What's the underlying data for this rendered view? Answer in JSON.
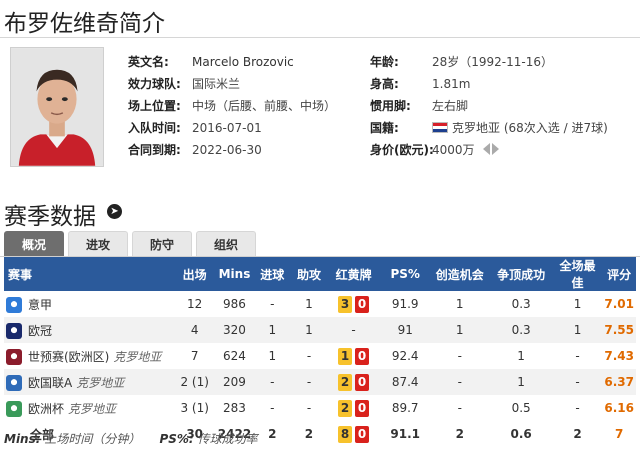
{
  "page_title": "布罗佐维奇简介",
  "profile": {
    "name_label": "英文名:",
    "name_value": "Marcelo Brozovic",
    "club_label": "效力球队:",
    "club_value": "国际米兰",
    "position_label": "场上位置:",
    "position_value": "中场（后腰、前腰、中场）",
    "joined_label": "入队时间:",
    "joined_value": "2016-07-01",
    "contract_label": "合同到期:",
    "contract_value": "2022-06-30",
    "age_label": "年龄:",
    "age_value": "28岁（1992-11-16）",
    "height_label": "身高:",
    "height_value": "1.81m",
    "foot_label": "惯用脚:",
    "foot_value": "左右脚",
    "nation_label": "国籍:",
    "nation_value": "克罗地亚 (68次入选 / 进7球)",
    "value_label": "身价(欧元):",
    "value_value": "4000万"
  },
  "section_title": "赛季数据",
  "tabs": [
    "概况",
    "进攻",
    "防守",
    "组织"
  ],
  "table": {
    "headers": [
      "赛事",
      "出场",
      "Mins",
      "进球",
      "助攻",
      "红黄牌",
      "PS%",
      "创造机会",
      "争顶成功",
      "全场最佳",
      "评分"
    ],
    "rows": [
      {
        "comp": "意甲",
        "note": "",
        "apps": "12",
        "mins": "986",
        "goals": "-",
        "assists": "1",
        "yellow": "3",
        "red": "0",
        "ps": "91.9",
        "chances": "1",
        "aerial": "0.3",
        "motm": "1",
        "rating": "7.01",
        "icon": "serie-a-icon",
        "icon_color": "#2f7bd8"
      },
      {
        "comp": "欧冠",
        "note": "",
        "apps": "4",
        "mins": "320",
        "goals": "1",
        "assists": "1",
        "yellow": "",
        "red": "",
        "ps": "91",
        "chances": "1",
        "aerial": "0.3",
        "motm": "1",
        "rating": "7.55",
        "icon": "champions-league-icon",
        "icon_color": "#1a2a6c"
      },
      {
        "comp": "世预赛(欧洲区)",
        "note": "克罗地亚",
        "apps": "7",
        "mins": "624",
        "goals": "1",
        "assists": "-",
        "yellow": "1",
        "red": "0",
        "ps": "92.4",
        "chances": "-",
        "aerial": "1",
        "motm": "-",
        "rating": "7.43",
        "icon": "world-cup-qualifier-icon",
        "icon_color": "#8b1c2c"
      },
      {
        "comp": "欧国联A",
        "note": "克罗地亚",
        "apps": "2 (1)",
        "mins": "209",
        "goals": "-",
        "assists": "-",
        "yellow": "2",
        "red": "0",
        "ps": "87.4",
        "chances": "-",
        "aerial": "1",
        "motm": "-",
        "rating": "6.37",
        "icon": "nations-league-icon",
        "icon_color": "#2f6bb8"
      },
      {
        "comp": "欧洲杯",
        "note": "克罗地亚",
        "apps": "3 (1)",
        "mins": "283",
        "goals": "-",
        "assists": "-",
        "yellow": "2",
        "red": "0",
        "ps": "89.7",
        "chances": "-",
        "aerial": "0.5",
        "motm": "-",
        "rating": "6.16",
        "icon": "euro-icon",
        "icon_color": "#3a9a5a"
      }
    ],
    "total": {
      "comp": "全部",
      "apps": "30",
      "mins": "2422",
      "goals": "2",
      "assists": "2",
      "yellow": "8",
      "red": "0",
      "ps": "91.1",
      "chances": "2",
      "aerial": "0.6",
      "motm": "2",
      "rating": "7"
    }
  },
  "footnote": {
    "mins_key": "Mins:",
    "mins_desc": "上场时间（分钟）",
    "ps_key": "PS%:",
    "ps_desc": "传球成功率"
  },
  "colors": {
    "header_blue": "#2b5a9b",
    "rating_orange": "#e06a00",
    "yellow_card": "#f7c22c",
    "red_card": "#d9221c"
  }
}
